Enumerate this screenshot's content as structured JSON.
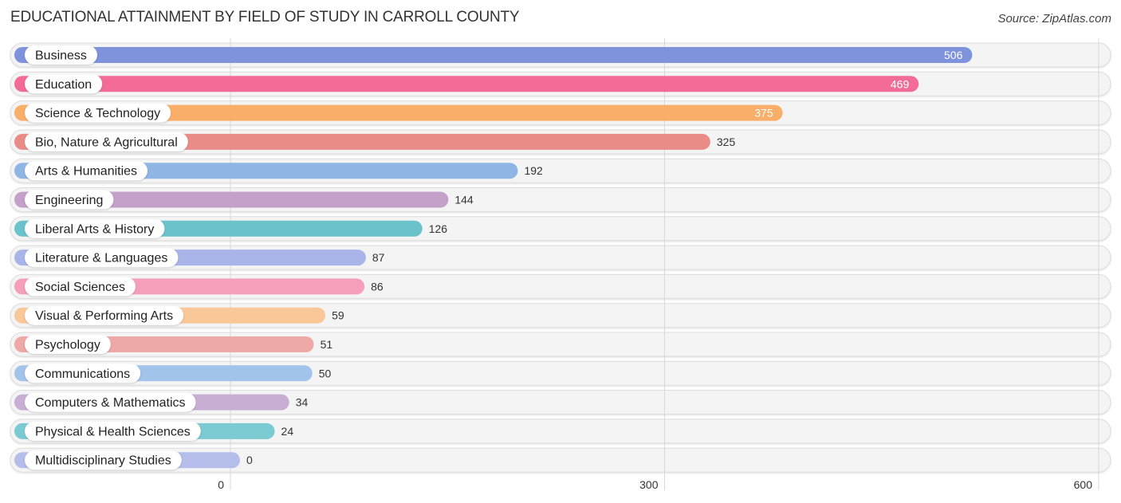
{
  "header": {
    "title": "EDUCATIONAL ATTAINMENT BY FIELD OF STUDY IN CARROLL COUNTY",
    "source": "Source: ZipAtlas.com"
  },
  "chart_data": {
    "type": "bar",
    "orientation": "horizontal",
    "title": "EDUCATIONAL ATTAINMENT BY FIELD OF STUDY IN CARROLL COUNTY",
    "xlabel": "",
    "ylabel": "",
    "xlim": [
      0,
      600
    ],
    "xticks": [
      0,
      300,
      600
    ],
    "grid": true,
    "categories": [
      "Business",
      "Education",
      "Science & Technology",
      "Bio, Nature & Agricultural",
      "Arts & Humanities",
      "Engineering",
      "Liberal Arts & History",
      "Literature & Languages",
      "Social Sciences",
      "Visual & Performing Arts",
      "Psychology",
      "Communications",
      "Computers & Mathematics",
      "Physical & Health Sciences",
      "Multidisciplinary Studies"
    ],
    "values": [
      506,
      469,
      375,
      325,
      192,
      144,
      126,
      87,
      86,
      59,
      51,
      50,
      34,
      24,
      0
    ],
    "colors": [
      "#7f93dc",
      "#f36b97",
      "#f9ae6a",
      "#e98c88",
      "#8eb5e4",
      "#c3a1c8",
      "#6bc2cb",
      "#a9b4e9",
      "#f59fba",
      "#fac799",
      "#eea8a6",
      "#a2c3ea",
      "#c8aed2",
      "#7ccad2",
      "#b5bdeb"
    ],
    "value_label_inside_threshold": 350
  }
}
